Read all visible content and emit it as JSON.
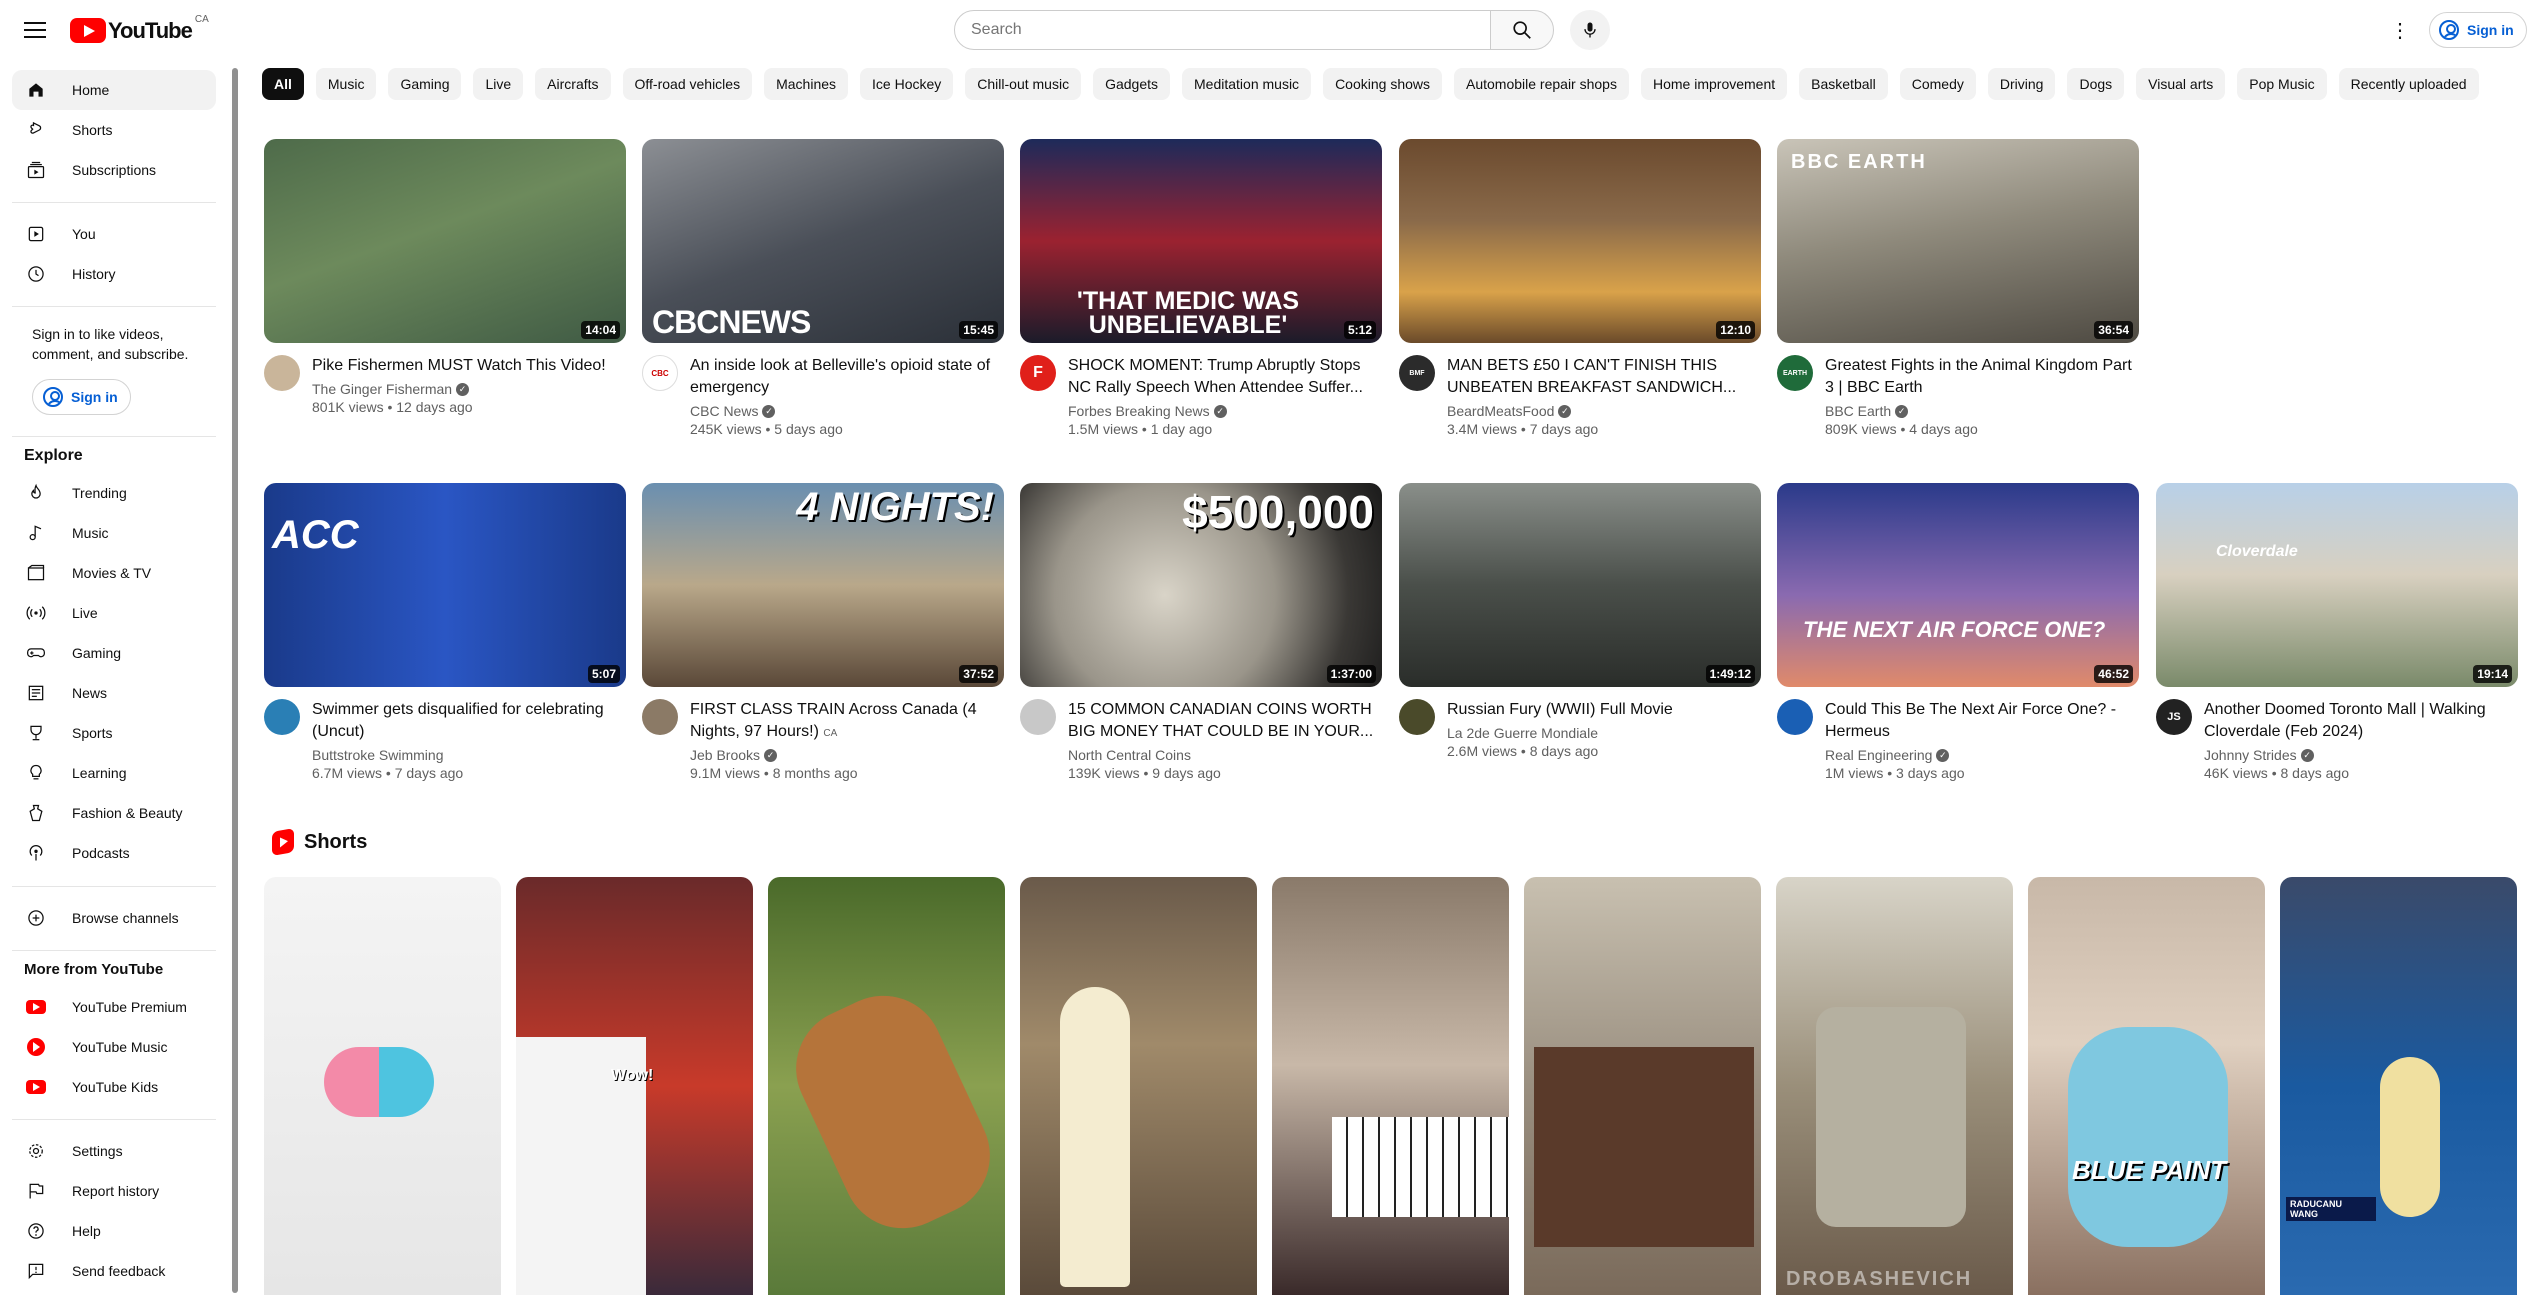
{
  "header": {
    "logo_text": "YouTube",
    "country_code": "CA",
    "search_placeholder": "Search",
    "signin_label": "Sign in"
  },
  "sidebar": {
    "main": [
      {
        "label": "Home",
        "icon": "home-icon"
      },
      {
        "label": "Shorts",
        "icon": "shorts-icon"
      },
      {
        "label": "Subscriptions",
        "icon": "subscriptions-icon"
      }
    ],
    "you": [
      {
        "label": "You",
        "icon": "you-icon"
      },
      {
        "label": "History",
        "icon": "history-icon"
      }
    ],
    "signin_prompt": "Sign in to like videos, comment, and subscribe.",
    "signin_label": "Sign in",
    "explore_title": "Explore",
    "explore": [
      {
        "label": "Trending",
        "icon": "trending-icon"
      },
      {
        "label": "Music",
        "icon": "music-icon"
      },
      {
        "label": "Movies & TV",
        "icon": "movies-icon"
      },
      {
        "label": "Live",
        "icon": "live-icon"
      },
      {
        "label": "Gaming",
        "icon": "gaming-icon"
      },
      {
        "label": "News",
        "icon": "news-icon"
      },
      {
        "label": "Sports",
        "icon": "sports-icon"
      },
      {
        "label": "Learning",
        "icon": "learning-icon"
      },
      {
        "label": "Fashion & Beauty",
        "icon": "fashion-icon"
      },
      {
        "label": "Podcasts",
        "icon": "podcasts-icon"
      }
    ],
    "browse_channels": "Browse channels",
    "more_title": "More from YouTube",
    "more": [
      {
        "label": "YouTube Premium",
        "icon": "youtube-premium-icon"
      },
      {
        "label": "YouTube Music",
        "icon": "youtube-music-icon"
      },
      {
        "label": "YouTube Kids",
        "icon": "youtube-kids-icon"
      }
    ],
    "footer": [
      {
        "label": "Settings",
        "icon": "settings-icon"
      },
      {
        "label": "Report history",
        "icon": "flag-icon"
      },
      {
        "label": "Help",
        "icon": "help-icon"
      },
      {
        "label": "Send feedback",
        "icon": "feedback-icon"
      }
    ]
  },
  "chips": [
    "All",
    "Music",
    "Gaming",
    "Live",
    "Aircrafts",
    "Off-road vehicles",
    "Machines",
    "Ice Hockey",
    "Chill-out music",
    "Gadgets",
    "Meditation music",
    "Cooking shows",
    "Automobile repair shops",
    "Home improvement",
    "Basketball",
    "Comedy",
    "Driving",
    "Dogs",
    "Visual arts",
    "Pop Music",
    "Recently uploaded"
  ],
  "videos": [
    {
      "title": "Pike Fishermen MUST Watch This Video!",
      "channel": "The Ginger Fisherman",
      "verified": true,
      "stats": "801K views • 12 days ago",
      "duration": "14:04"
    },
    {
      "title": "An inside look at Belleville's opioid state of emergency",
      "channel": "CBC News",
      "verified": true,
      "stats": "245K views • 5 days ago",
      "duration": "15:45",
      "overlay": "CBCNEWS"
    },
    {
      "title": "SHOCK MOMENT: Trump Abruptly Stops NC Rally Speech When Attendee Suffer...",
      "channel": "Forbes Breaking News",
      "verified": true,
      "stats": "1.5M views • 1 day ago",
      "duration": "5:12",
      "overlay": "'THAT MEDIC WAS UNBELIEVABLE'"
    },
    {
      "title": "MAN BETS £50 I CAN'T FINISH THIS UNBEATEN BREAKFAST SANDWICH...",
      "channel": "BeardMeatsFood",
      "verified": true,
      "stats": "3.4M views • 7 days ago",
      "duration": "12:10"
    },
    {
      "title": "Greatest Fights in the Animal Kingdom Part 3 | BBC Earth",
      "channel": "BBC Earth",
      "verified": true,
      "stats": "809K views • 4 days ago",
      "duration": "36:54",
      "overlay": "BBC EARTH"
    },
    {
      "title": "Swimmer gets disqualified for celebrating (Uncut)",
      "channel": "Buttstroke Swimming",
      "verified": false,
      "stats": "6.7M views • 7 days ago",
      "duration": "5:07",
      "overlay": "ACC"
    },
    {
      "title": "FIRST CLASS TRAIN Across Canada (4 Nights, 97 Hours!)",
      "title_badge": "CA",
      "channel": "Jeb Brooks",
      "verified": true,
      "stats": "9.1M views • 8 months ago",
      "duration": "37:52",
      "overlay": "4 NIGHTS!"
    },
    {
      "title": "15 COMMON CANADIAN COINS WORTH BIG MONEY THAT COULD BE IN YOUR...",
      "channel": "North Central Coins",
      "verified": false,
      "stats": "139K views • 9 days ago",
      "duration": "1:37:00",
      "overlay": "$500,000"
    },
    {
      "title": "Russian Fury (WWII) Full Movie",
      "channel": "La 2de Guerre Mondiale",
      "verified": false,
      "stats": "2.6M views • 8 days ago",
      "duration": "1:49:12"
    },
    {
      "title": "Could This Be The Next Air Force One? - Hermeus",
      "channel": "Real Engineering",
      "verified": true,
      "stats": "1M views • 3 days ago",
      "duration": "46:52",
      "overlay": "THE NEXT AIR FORCE ONE?"
    },
    {
      "title": "Another Doomed Toronto Mall | Walking Cloverdale (Feb 2024)",
      "channel": "Johnny Strides",
      "verified": true,
      "stats": "46K views • 8 days ago",
      "duration": "19:14",
      "overlay": "Cloverdale"
    }
  ],
  "shorts": {
    "title": "Shorts",
    "items": [
      {
        "overlay": ""
      },
      {
        "overlay": "Wow!"
      },
      {
        "overlay": ""
      },
      {
        "overlay": ""
      },
      {
        "overlay": ""
      },
      {
        "overlay": ""
      },
      {
        "overlay": "DROBASHEVICH"
      },
      {
        "overlay": "BLUE PAINT"
      },
      {
        "overlay": "RADUCANU WANG"
      }
    ]
  },
  "colors": {
    "brand_red": "#ff0000",
    "link_blue": "#065fd4",
    "chip_bg": "#f2f2f2",
    "text_secondary": "#606060"
  }
}
